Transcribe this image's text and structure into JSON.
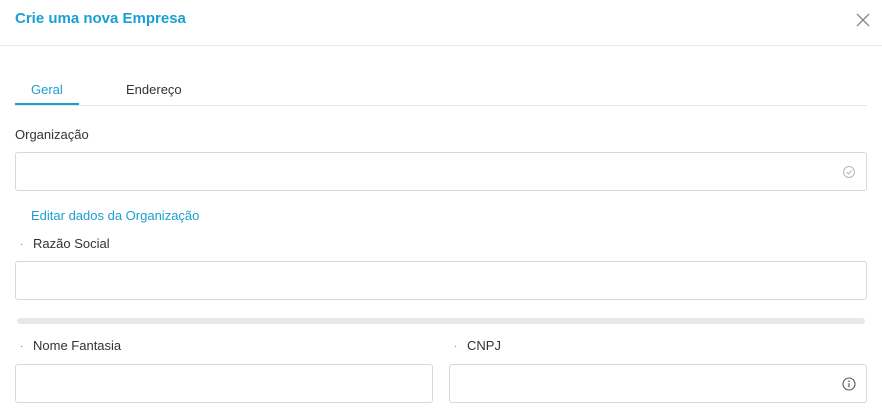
{
  "modal": {
    "title": "Crie uma nova Empresa",
    "close_icon": "close-icon"
  },
  "tabs": [
    {
      "label": "Geral",
      "active": true
    },
    {
      "label": "Endereço",
      "active": false
    }
  ],
  "accent_color": "#1aa0d0",
  "required_color": "#e04848",
  "form": {
    "organizacao": {
      "label": "Organização",
      "value": "",
      "icon": "check-circle-icon"
    },
    "edit_org_link": "Editar dados da Organização",
    "razao_social": {
      "label": "Razão Social",
      "value": "",
      "required": true
    },
    "nome_fantasia": {
      "label": "Nome Fantasia",
      "value": "",
      "required": true
    },
    "cnpj": {
      "label": "CNPJ",
      "value": "",
      "required": true,
      "icon": "info-icon"
    },
    "required_marker": "·"
  }
}
